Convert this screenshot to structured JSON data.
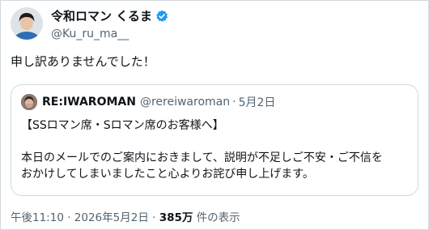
{
  "author": {
    "display_name": "令和ロマン くるま",
    "handle": "@Ku_ru_ma__",
    "verified_icon": "verified-badge-icon",
    "verified_color": "#1d9bf0"
  },
  "tweet": {
    "text": "申し訳ありませんでした！"
  },
  "quoted": {
    "name": "RE:IWAROMAN",
    "handle": "@rereiwaroman",
    "separator": "·",
    "date": "5月2日",
    "lines": [
      "【SSロマン席・Sロマン席のお客様へ】",
      "",
      "本日のメールでのご案内におきまして、説明が不足しご不安・ご不信を",
      "おかけしてしまいましたこと心よりお詫び申し上げます。"
    ]
  },
  "meta": {
    "time_date": "午後11:10 · 2026年5月2日 · ",
    "views_count": "385万",
    "views_label": " 件の表示"
  }
}
